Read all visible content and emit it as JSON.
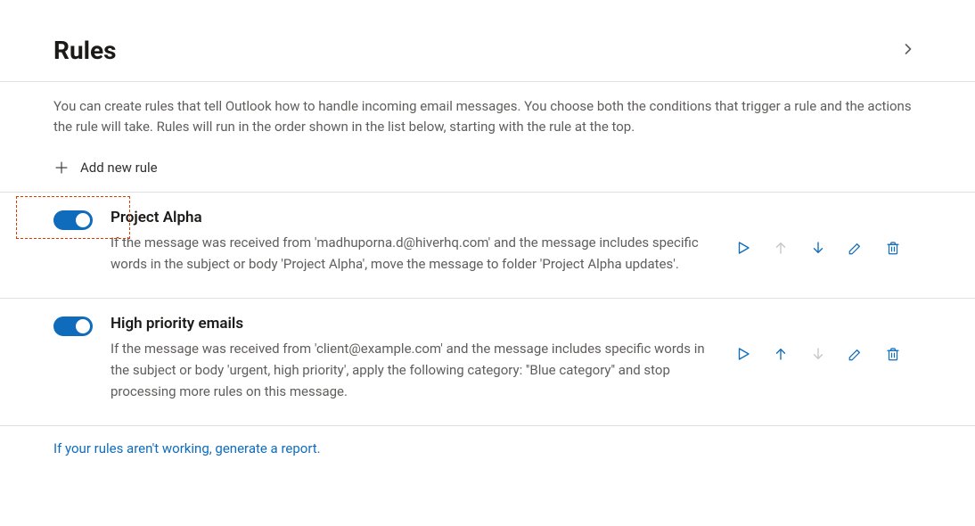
{
  "header": {
    "title": "Rules"
  },
  "intro": {
    "text": "You can create rules that tell Outlook how to handle incoming email messages. You choose both the conditions that trigger a rule and the actions the rule will take. Rules will run in the order shown in the list below, starting with the rule at the top."
  },
  "addRule": {
    "label": "Add new rule"
  },
  "rules": [
    {
      "enabled": true,
      "name": "Project Alpha",
      "description": "If the message was received from 'madhuporna.d@hiverhq.com' and the message includes specific words in the subject or body 'Project Alpha', move the message to folder 'Project Alpha updates'.",
      "upDisabled": true,
      "downDisabled": false,
      "highlighted": true
    },
    {
      "enabled": true,
      "name": "High priority emails",
      "description": "If the message was received from 'client@example.com' and the message includes specific words in the subject or body 'urgent, high priority', apply the following category: ''Blue category'' and stop processing more rules on this message.",
      "upDisabled": false,
      "downDisabled": true,
      "highlighted": false
    }
  ],
  "reportLink": {
    "text": "If your rules aren't working, generate a report."
  },
  "colors": {
    "accent": "#0f6cbd",
    "textPrimary": "#1b1a19",
    "textSecondary": "#605e5c",
    "disabled": "#c8c6c4",
    "highlight": "#d83b01"
  }
}
